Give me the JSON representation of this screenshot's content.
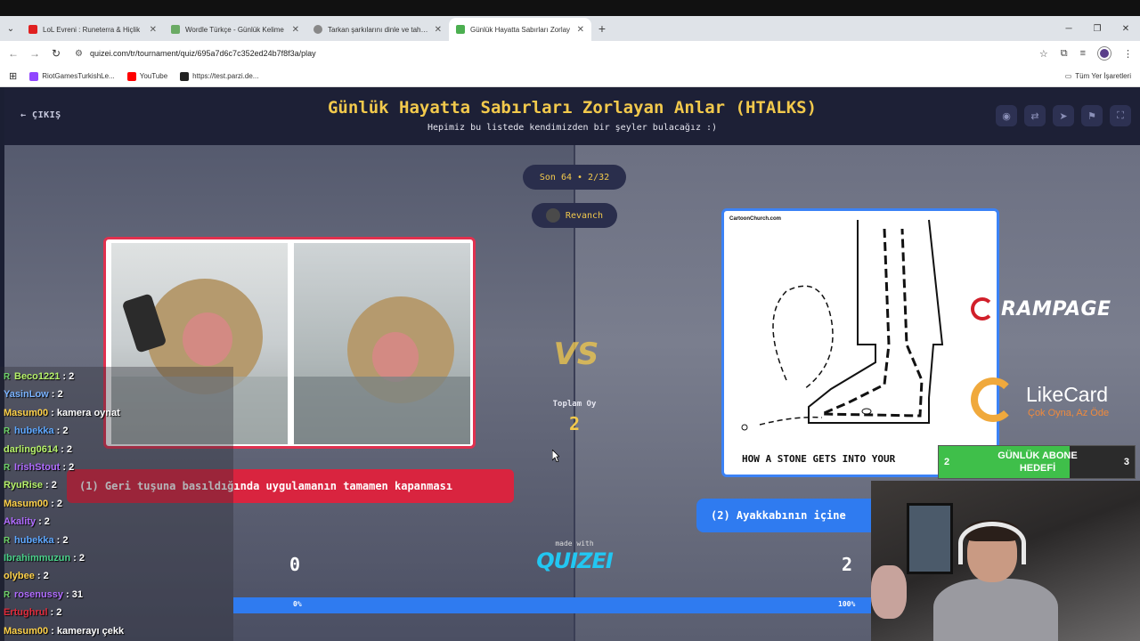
{
  "browser": {
    "tabs": [
      {
        "title": "LoL Evreni : Runeterra & Hiçlik",
        "color": "#e02020"
      },
      {
        "title": "Wordle Türkçe - Günlük Kelime",
        "color": "#6aaa64"
      },
      {
        "title": "Tarkan şarkılarını dinle ve tahmin",
        "color": "#888888"
      },
      {
        "title": "Günlük Hayatta Sabırları Zorlay",
        "color": "#4caf50"
      }
    ],
    "url": "quizei.com/tr/tournament/quiz/695a7d6c7c352ed24b7f8f3a/play",
    "bookmarks": [
      {
        "label": "RiotGamesTurkishLe...",
        "color": "#9146ff"
      },
      {
        "label": "YouTube",
        "color": "#ff0000"
      },
      {
        "label": "https://test.parzi.de...",
        "color": "#222222"
      }
    ],
    "all_bookmarks": "Tüm Yer İşaretleri"
  },
  "header": {
    "exit_label": "ÇIKIŞ",
    "title": "Günlük Hayatta Sabırları Zorlayan Anlar (HTALKS)",
    "subtitle": "Hepimiz bu listede kendimizden bir şeyler bulacağız :)"
  },
  "round": {
    "label": "Son 64 • 2/32",
    "revanch": "Revanch"
  },
  "vs": {
    "text": "VS",
    "total_label": "Toplam Oy",
    "total_value": "2"
  },
  "left_option": {
    "label": "(1) Geri tuşuna basıldığında uygulamanın tamamen kapanması",
    "score": "0",
    "percent": "0%",
    "fraction": 0
  },
  "right_option": {
    "label": "(2) Ayakkabının içine",
    "score": "2",
    "percent": "100%",
    "cartoon_caption": "HOW A STONE GETS INTO YOUR",
    "cartoon_source": "CartoonChurch.com"
  },
  "footer": {
    "made_with": "made with",
    "brand": "QUIZEI"
  },
  "overlays": {
    "rampage": "RAMPAGE",
    "likecard": "LikeCard",
    "likecard_slogan": "Çok Oyna, Az Öde",
    "sub_goal": {
      "left": "2",
      "center": "GÜNLÜK ABONE HEDEFİ",
      "right": "3",
      "fraction": 0.6667
    }
  },
  "chat": [
    {
      "user": "Beco1221",
      "msg": "2",
      "color": "#b6f26a",
      "badge": true
    },
    {
      "user": "YasinLow",
      "msg": "2",
      "color": "#7ab3ff",
      "badge": false
    },
    {
      "user": "Masum00",
      "msg": "kamera oynat",
      "color": "#ffd24a",
      "badge": false
    },
    {
      "user": "hubekka",
      "msg": "2",
      "color": "#5fa8ff",
      "badge": true
    },
    {
      "user": "darling0614",
      "msg": "2",
      "color": "#b6f26a",
      "badge": false
    },
    {
      "user": "IrishStout",
      "msg": "2",
      "color": "#b06cff",
      "badge": true
    },
    {
      "user": "RyuRise",
      "msg": "2",
      "color": "#b6f26a",
      "badge": false
    },
    {
      "user": "Masum00",
      "msg": "2",
      "color": "#ffd24a",
      "badge": false
    },
    {
      "user": "Akality",
      "msg": "2",
      "color": "#b06cff",
      "badge": false
    },
    {
      "user": "hubekka",
      "msg": "2",
      "color": "#5fa8ff",
      "badge": true
    },
    {
      "user": "Ibrahimmuzun",
      "msg": "2",
      "color": "#4ad18a",
      "badge": false
    },
    {
      "user": "olybee",
      "msg": "2",
      "color": "#ffd24a",
      "badge": false
    },
    {
      "user": "rosenussy",
      "msg": "31",
      "color": "#b06cff",
      "badge": true
    },
    {
      "user": "Ertughrul",
      "msg": "2",
      "color": "#e02a3a",
      "badge": false
    },
    {
      "user": "Masum00",
      "msg": "kamerayı çekk",
      "color": "#ffd24a",
      "badge": false
    }
  ]
}
